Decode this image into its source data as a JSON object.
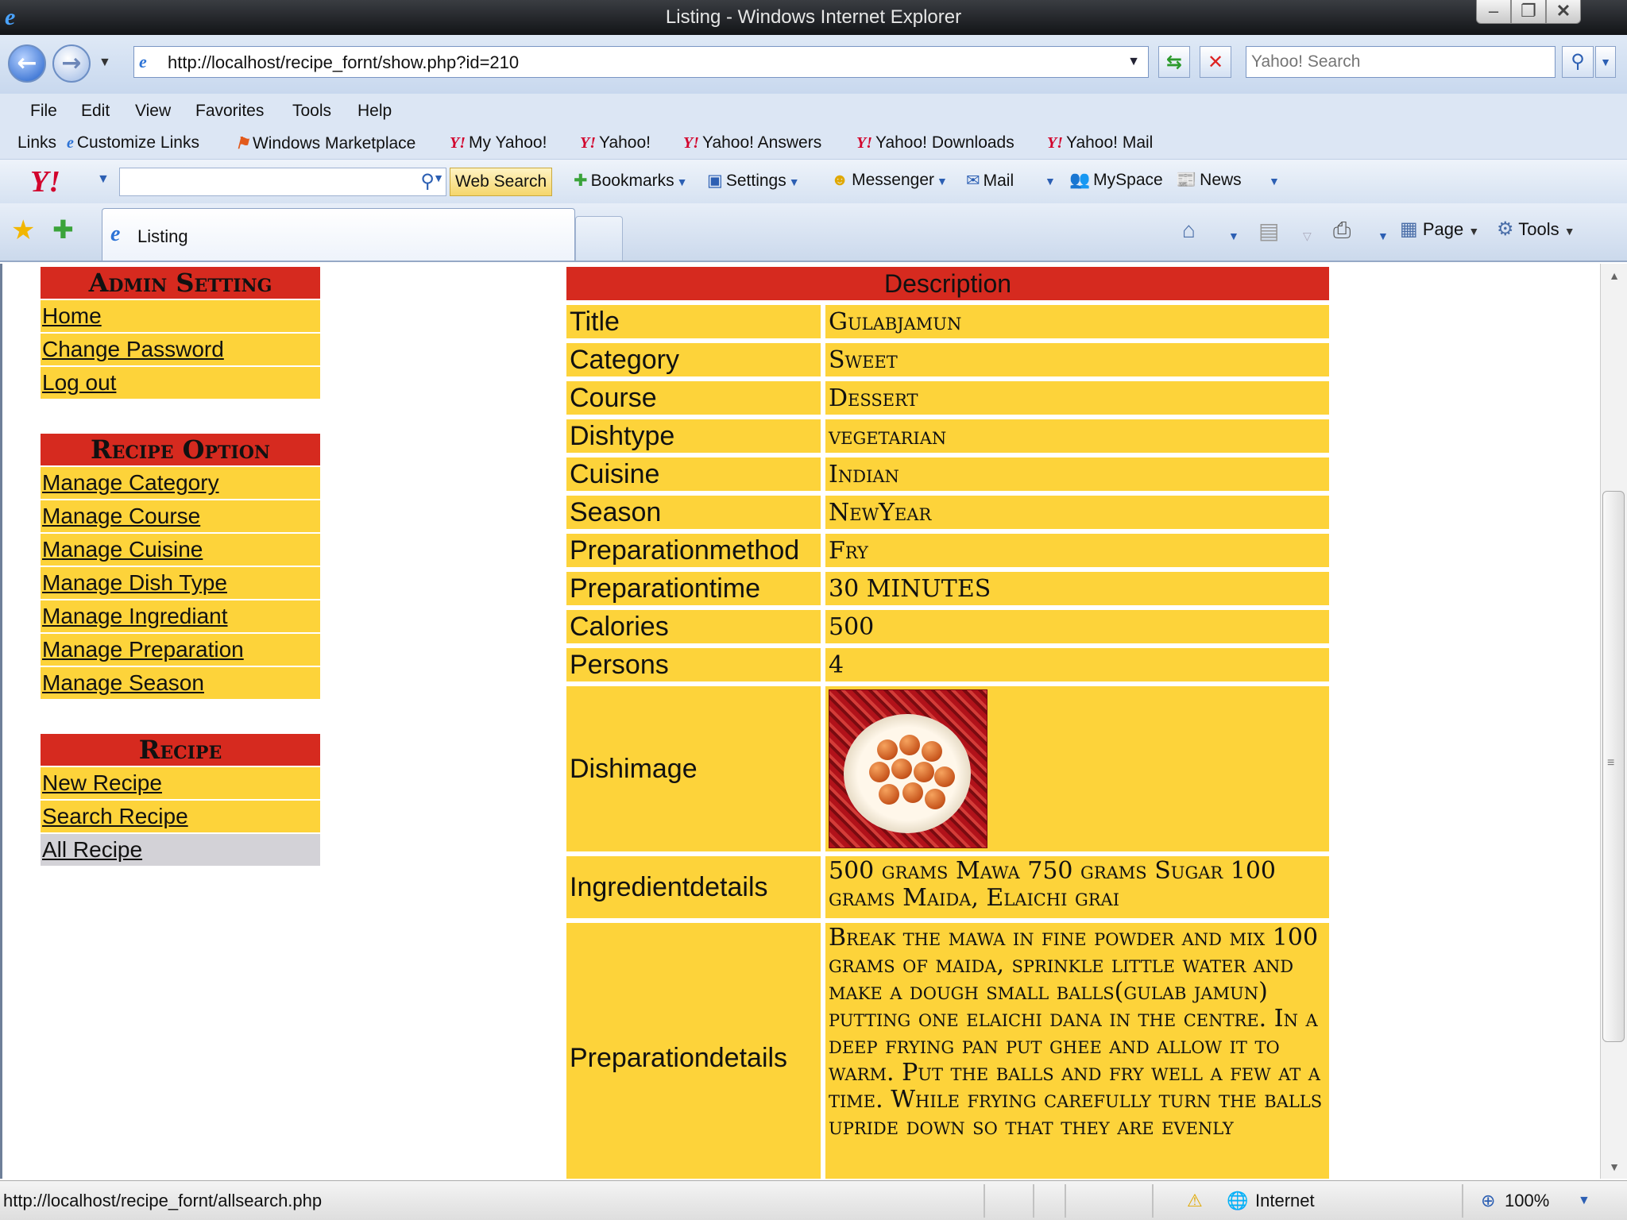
{
  "window": {
    "title": "Listing - Windows Internet Explorer"
  },
  "address": {
    "url": "http://localhost/recipe_fornt/show.php?id=210",
    "search_placeholder": "Yahoo! Search"
  },
  "menu": [
    "File",
    "Edit",
    "View",
    "Favorites",
    "Tools",
    "Help"
  ],
  "links": {
    "label": "Links",
    "items": [
      "Customize Links",
      "Windows Marketplace",
      "My Yahoo!",
      "Yahoo!",
      "Yahoo! Answers",
      "Yahoo! Downloads",
      "Yahoo! Mail"
    ]
  },
  "yahoo_toolbar": {
    "web_search": "Web Search",
    "bookmarks": "Bookmarks",
    "settings": "Settings",
    "messenger": "Messenger",
    "mail": "Mail",
    "myspace": "MySpace",
    "news": "News"
  },
  "tab": {
    "label": "Listing"
  },
  "commands": {
    "page": "Page",
    "tools": "Tools"
  },
  "sidebar": {
    "admin": {
      "heading": "Admin Setting",
      "links": [
        "Home",
        "Change Password",
        "Log out"
      ]
    },
    "recipe_option": {
      "heading": "Recipe Option",
      "links": [
        "Manage Category",
        "Manage Course",
        "Manage Cuisine",
        "Manage Dish Type",
        "Manage Ingrediant",
        "Manage Preparation",
        "Manage Season"
      ]
    },
    "recipe": {
      "heading": "Recipe",
      "links": [
        "New Recipe",
        "Search Recipe",
        "All Recipe"
      ]
    }
  },
  "description": {
    "heading": "Description",
    "rows": [
      {
        "label": "Title",
        "value": "Gulabjamun"
      },
      {
        "label": "Category",
        "value": "Sweet"
      },
      {
        "label": "Course",
        "value": "Dessert"
      },
      {
        "label": "Dishtype",
        "value": "vegetarian"
      },
      {
        "label": "Cuisine",
        "value": "Indian"
      },
      {
        "label": "Season",
        "value": "NewYear"
      },
      {
        "label": "Preparationmethod",
        "value": "Fry"
      },
      {
        "label": "Preparationtime",
        "value": "30 MINUTES"
      },
      {
        "label": "Calories",
        "value": "500"
      },
      {
        "label": "Persons",
        "value": "4"
      }
    ],
    "dishimage_label": "Dishimage",
    "ingredient_label": "Ingredientdetails",
    "ingredient_value": "500 grams Mawa 750 grams Sugar 100 grams Maida, Elaichi grai",
    "preparation_label": "Preparationdetails",
    "preparation_value": "Break the mawa in fine powder and mix 100 grams of maida, sprinkle little water and make a dough small balls(gulab jamun) putting one elaichi dana in the centre. In a deep frying pan put ghee and allow it to warm. Put the balls and fry well a few at a time. While frying carefully turn the balls upride down so that they are evenly"
  },
  "status": {
    "text": "http://localhost/recipe_fornt/allsearch.php",
    "zone": "Internet",
    "zoom": "100%"
  }
}
